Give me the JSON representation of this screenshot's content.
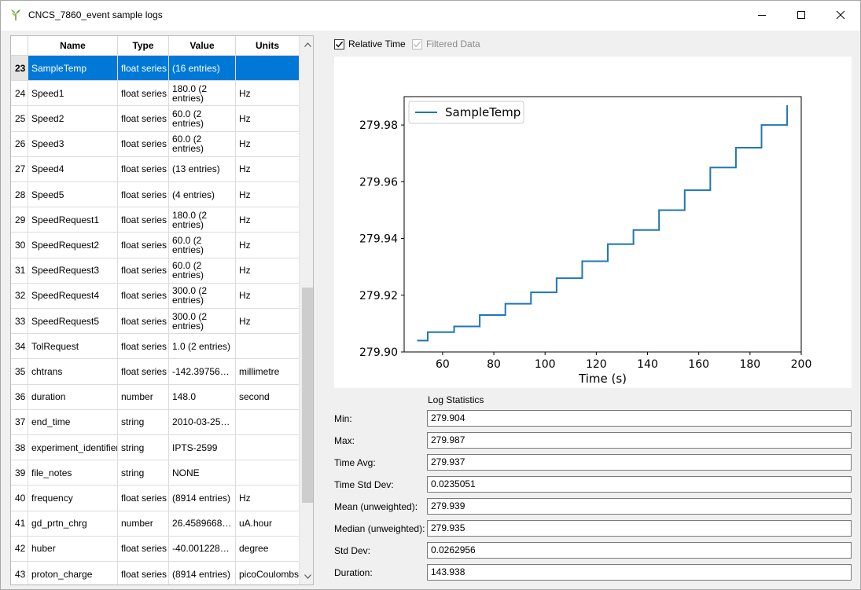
{
  "window": {
    "title": "CNCS_7860_event sample logs",
    "minimize_glyph": "–",
    "maximize_glyph": "☐",
    "close_glyph": "✕"
  },
  "table": {
    "headers": [
      "Name",
      "Type",
      "Value",
      "Units"
    ],
    "rows": [
      {
        "num": "23",
        "name": "SampleTemp",
        "type": "float series",
        "value": "(16 entries)",
        "units": "",
        "selected": true
      },
      {
        "num": "24",
        "name": "Speed1",
        "type": "float series",
        "value": "180.0 (2 entries)",
        "units": "Hz"
      },
      {
        "num": "25",
        "name": "Speed2",
        "type": "float series",
        "value": "60.0 (2 entries)",
        "units": "Hz"
      },
      {
        "num": "26",
        "name": "Speed3",
        "type": "float series",
        "value": "60.0 (2 entries)",
        "units": "Hz"
      },
      {
        "num": "27",
        "name": "Speed4",
        "type": "float series",
        "value": "(13 entries)",
        "units": "Hz"
      },
      {
        "num": "28",
        "name": "Speed5",
        "type": "float series",
        "value": "(4 entries)",
        "units": "Hz"
      },
      {
        "num": "29",
        "name": "SpeedRequest1",
        "type": "float series",
        "value": "180.0 (2 entries)",
        "units": "Hz"
      },
      {
        "num": "30",
        "name": "SpeedRequest2",
        "type": "float series",
        "value": "60.0 (2 entries)",
        "units": "Hz"
      },
      {
        "num": "31",
        "name": "SpeedRequest3",
        "type": "float series",
        "value": "60.0 (2 entries)",
        "units": "Hz"
      },
      {
        "num": "32",
        "name": "SpeedRequest4",
        "type": "float series",
        "value": "300.0 (2 entries)",
        "units": "Hz"
      },
      {
        "num": "33",
        "name": "SpeedRequest5",
        "type": "float series",
        "value": "300.0 (2 entries)",
        "units": "Hz"
      },
      {
        "num": "34",
        "name": "TolRequest",
        "type": "float series",
        "value": "1.0 (2 entries)",
        "units": ""
      },
      {
        "num": "35",
        "name": "chtrans",
        "type": "float series",
        "value": "-142.39756…",
        "units": "millimetre"
      },
      {
        "num": "36",
        "name": "duration",
        "type": "number",
        "value": "148.0",
        "units": "second"
      },
      {
        "num": "37",
        "name": "end_time",
        "type": "string",
        "value": "2010-03-25…",
        "units": ""
      },
      {
        "num": "38",
        "name": "experiment_identifier",
        "type": "string",
        "value": "IPTS-2599",
        "units": ""
      },
      {
        "num": "39",
        "name": "file_notes",
        "type": "string",
        "value": "NONE",
        "units": ""
      },
      {
        "num": "40",
        "name": "frequency",
        "type": "float series",
        "value": "(8914 entries)",
        "units": "Hz"
      },
      {
        "num": "41",
        "name": "gd_prtn_chrg",
        "type": "number",
        "value": "26.4589668…",
        "units": "uA.hour"
      },
      {
        "num": "42",
        "name": "huber",
        "type": "float series",
        "value": "-40.001228…",
        "units": "degree"
      },
      {
        "num": "43",
        "name": "proton_charge",
        "type": "float series",
        "value": "(8914 entries)",
        "units": "picoCoulombs"
      }
    ]
  },
  "options": {
    "relative_time_label": "Relative Time",
    "relative_time_checked": true,
    "filtered_data_label": "Filtered Data",
    "filtered_data_checked": true,
    "filtered_data_enabled": false
  },
  "chart_data": {
    "type": "line",
    "drawstyle": "steps-post",
    "xlabel": "Time (s)",
    "ylabel": "",
    "xlim": [
      45,
      200
    ],
    "ylim": [
      279.9,
      279.99
    ],
    "xticks": [
      60,
      80,
      100,
      120,
      140,
      160,
      180,
      200
    ],
    "yticks": [
      279.9,
      279.92,
      279.94,
      279.96,
      279.98
    ],
    "ytick_labels": [
      "279.90",
      "279.92",
      "279.94",
      "279.96",
      "279.98"
    ],
    "legend_position": "upper-left",
    "series": [
      {
        "name": "SampleTemp",
        "color": "#1f77b4",
        "x": [
          50.1,
          54.2,
          64.5,
          74.5,
          84.5,
          94.5,
          104.5,
          114.5,
          124.5,
          134.5,
          144.5,
          154.5,
          164.5,
          174.5,
          184.5,
          194.5
        ],
        "y": [
          279.904,
          279.907,
          279.909,
          279.913,
          279.917,
          279.921,
          279.926,
          279.932,
          279.938,
          279.943,
          279.95,
          279.957,
          279.965,
          279.972,
          279.98,
          279.987
        ]
      }
    ]
  },
  "stats": {
    "title": "Log Statistics",
    "rows": [
      {
        "label": "Min:",
        "value": "279.904"
      },
      {
        "label": "Max:",
        "value": "279.987"
      },
      {
        "label": "Time Avg:",
        "value": "279.937"
      },
      {
        "label": "Time Std Dev:",
        "value": "0.0235051"
      },
      {
        "label": "Mean (unweighted):",
        "value": "279.939"
      },
      {
        "label": "Median (unweighted):",
        "value": "279.935"
      },
      {
        "label": "Std Dev:",
        "value": "0.0262956"
      },
      {
        "label": "Duration:",
        "value": "143.938"
      }
    ]
  }
}
